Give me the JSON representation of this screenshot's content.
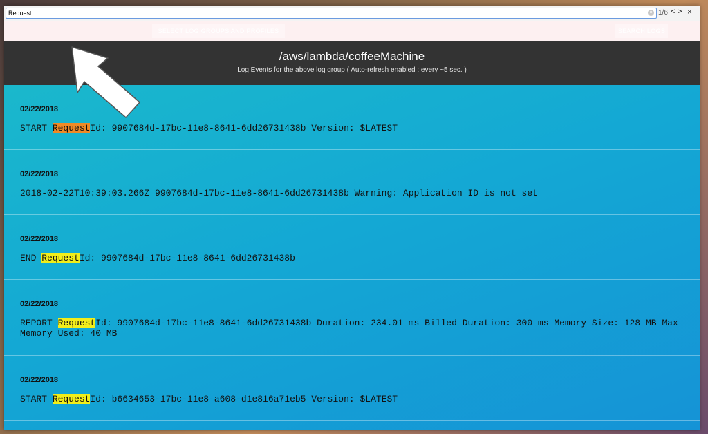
{
  "find_bar": {
    "query": "Request",
    "match_count": "1/6",
    "prev_label": "<",
    "next_label": ">",
    "close_label": "×"
  },
  "toolbar": {
    "left_label": "",
    "select_label": "SELECT LOG GROUPS AND PROFILES",
    "search_label": "SEARCH LOGS"
  },
  "header": {
    "title": "/aws/lambda/coffeeMachine",
    "subtitle": "Log Events for the above log group ( Auto-refresh enabled : every ~5 sec. )"
  },
  "logs": [
    {
      "date": "02/22/2018",
      "pre": "START ",
      "match": "Request",
      "post": "Id: 9907684d-17bc-11e8-8641-6dd26731438b Version: $LATEST",
      "active": true
    },
    {
      "date": "02/22/2018",
      "pre": "2018-02-22T10:39:03.266Z 9907684d-17bc-11e8-8641-6dd26731438b Warning: Application ID is not set",
      "match": "",
      "post": "",
      "active": false
    },
    {
      "date": "02/22/2018",
      "pre": "END ",
      "match": "Request",
      "post": "Id: 9907684d-17bc-11e8-8641-6dd26731438b",
      "active": false
    },
    {
      "date": "02/22/2018",
      "pre": "REPORT ",
      "match": "Request",
      "post": "Id: 9907684d-17bc-11e8-8641-6dd26731438b Duration: 234.01 ms Billed Duration: 300 ms Memory Size: 128 MB Max Memory Used: 40 MB",
      "active": false
    },
    {
      "date": "02/22/2018",
      "pre": "START ",
      "match": "Request",
      "post": "Id: b6634653-17bc-11e8-a608-d1e816a71eb5 Version: $LATEST",
      "active": false
    }
  ]
}
